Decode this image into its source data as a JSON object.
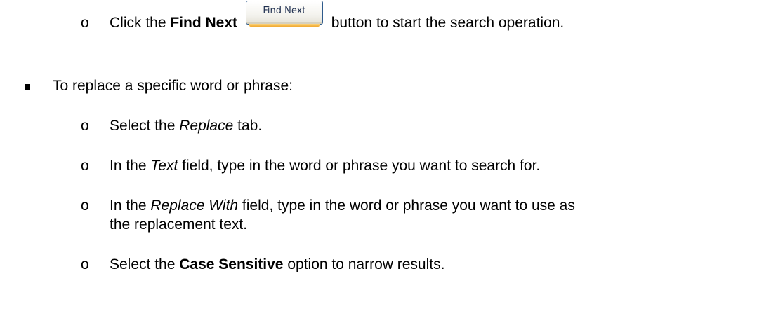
{
  "item1": {
    "pre": "Click the ",
    "bold": "Find Next",
    "button_label": "Find Next",
    "post": "button to start the search operation."
  },
  "replace_intro": "To replace a specific word or phrase:",
  "step1": {
    "pre": "Select the ",
    "italic": "Replace",
    "post": " tab."
  },
  "step2": {
    "pre": "In the ",
    "italic": "Text",
    "post": " field, type in the word or phrase you want to search for."
  },
  "step3": {
    "pre": "In the ",
    "italic": "Replace With",
    "post": " field, type in the word or phrase you want to use as",
    "continuation": "the replacement text."
  },
  "step4": {
    "pre": "Select the ",
    "bold": "Case Sensitive",
    "post": " option to narrow results."
  },
  "bullets": {
    "sub": "o"
  }
}
